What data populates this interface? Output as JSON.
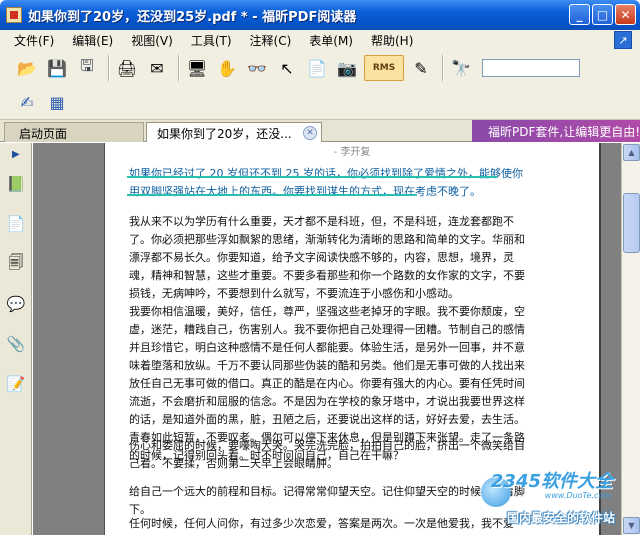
{
  "window": {
    "title": "如果你到了20岁，还没到25岁.pdf * - 福昕PDF阅读器",
    "minimize_glyph": "_",
    "maximize_glyph": "□",
    "close_glyph": "✕"
  },
  "menu": {
    "items": [
      "文件(F)",
      "编辑(E)",
      "视图(V)",
      "工具(T)",
      "注释(C)",
      "表单(M)",
      "帮助(H)"
    ]
  },
  "toolbar": {
    "rms_label": "RMS",
    "search_value": ""
  },
  "tabs": {
    "start_label": "启动页面",
    "doc_label": "如果你到了20岁，还没...",
    "close_glyph": "✕",
    "promo_text": "福昕PDF套件,让编辑更自由!"
  },
  "document": {
    "page_header": "- 李开复",
    "paragraphs": [
      "如果你已经过了 20 岁但还不到 25 岁的话，你必须找到除了爱情之外，能够使你用双脚坚强站在大地上的东西。你要找到谋生的方式，现在考虑不晚了。",
      "我从来不以为学历有什么重要，天才都不是科班，但，不是科班，连龙套都跑不了。你必须把那些浮如飘絮的思绪，渐渐转化为清晰的思路和简单的文字。华丽和漂浮都不易长久。你要知道，给予文字阅读快感不够的，内容，思想，境界，灵魂，精神和智慧，这些才重要。不要多看那些和你一个路数的女作家的文字，不要损钱，无病呻吟，不要想到什么就写，不要流连于小感伤和小感动。",
      "我要你相信温暖，美好，信任，尊严，坚强这些老掉牙的字眼。我不要你颓废，空虚，迷茫，糟践自己，伤害别人。我不要你把自己处理得一团糟。节制自己的感情并且珍惜它，明白这种感情不是任何人都能要。体验生活，是另外一回事，并不意味着堕落和放纵。千万不要认同那些伪装的酷和另类。他们是无事可做的人找出来放任自己无事可做的借口。真正的酷是在内心。你要有强大的内心。要有任凭时间流逝，不会磨折和屈服的信念。不是因为在学校的象牙塔中，才说出我要世界这样的话，是知道外面的黑，脏，丑陋之后，还要说出这样的话，好好去爱，去生活。青春如此短暂，不要叹老。偶尔可以停下来休息，但是别蹲下来张望。走了一条路的时候，记得别回头看。时不时问问自己，自己在干嘛？",
      "伤心和委屈的时候，要嚎啕大哭。哭完洗完脸，拍拍自己的脸，挤出一个微笑给自己看。不要揉，否则第二天早上会眼睛肿。",
      "给自己一个远大的前程和目标。记得常常仰望天空。记住仰望天空的时候也看看脚下。",
      "任何时候，任何人问你，有过多少次恋爱，答案是两次。一次是他爱我，我不爱他。一次是"
    ]
  },
  "watermark": {
    "logo": "2345软件大全",
    "url": "www.DuoTe.com",
    "slogan": "国内最安全的软件站"
  },
  "colors": {
    "titlebar": "#0653c8",
    "chrome": "#f1efe2",
    "highlight": "#28c0b0",
    "promo": "#8a4aa8"
  }
}
